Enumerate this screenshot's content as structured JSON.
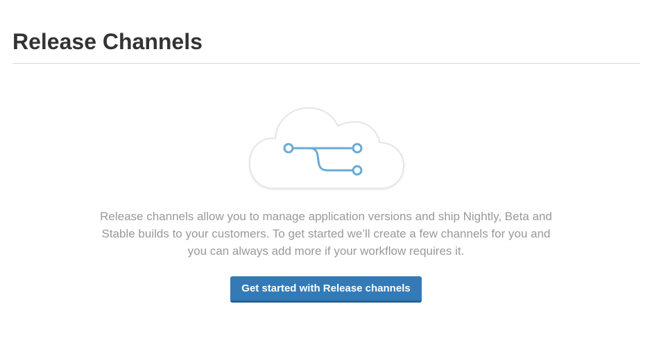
{
  "header": {
    "title": "Release Channels"
  },
  "empty_state": {
    "icon": "cloud-branch-icon",
    "description_lines": [
      "Release channels allow you to manage application versions and ship Nightly, Beta and",
      "Stable builds to your customers. To get started we’ll create a few channels for you and",
      "you can always add more if your workflow requires it."
    ],
    "cta_label": "Get started with Release channels"
  },
  "colors": {
    "accent": "#337ab7",
    "title_text": "#333333",
    "muted_text": "#999999",
    "icon_stroke": "#6aaad6",
    "divider": "#d6d6d6"
  }
}
